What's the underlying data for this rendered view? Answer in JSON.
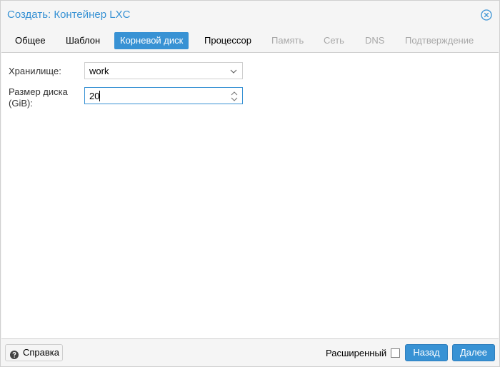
{
  "window": {
    "title": "Создать: Контейнер LXC"
  },
  "tabs": [
    {
      "label": "Общее",
      "state": "normal"
    },
    {
      "label": "Шаблон",
      "state": "normal"
    },
    {
      "label": "Корневой диск",
      "state": "active"
    },
    {
      "label": "Процессор",
      "state": "normal"
    },
    {
      "label": "Память",
      "state": "disabled"
    },
    {
      "label": "Сеть",
      "state": "disabled"
    },
    {
      "label": "DNS",
      "state": "disabled"
    },
    {
      "label": "Подтверждение",
      "state": "disabled"
    }
  ],
  "form": {
    "storage_label": "Хранилище:",
    "storage_value": "work",
    "disk_size_label_line1": "Размер диска",
    "disk_size_label_line2": "(GiB):",
    "disk_size_value": "20"
  },
  "footer": {
    "help_label": "Справка",
    "advanced_label": "Расширенный",
    "advanced_checked": false,
    "back_label": "Назад",
    "next_label": "Далее"
  },
  "colors": {
    "accent": "#3892d4"
  },
  "icons": {
    "close": "close-circle-icon",
    "help": "question-circle-icon",
    "dropdown": "chevron-down-icon",
    "spinner": "spinner-arrows-icon"
  }
}
